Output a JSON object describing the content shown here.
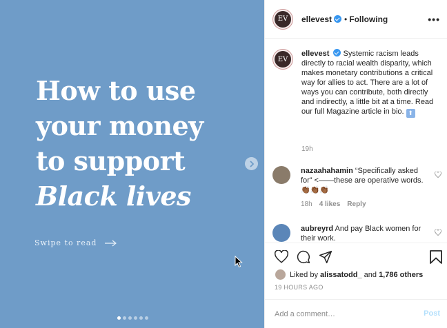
{
  "post_image": {
    "headline_lines": [
      "How to use",
      "your money",
      "to support"
    ],
    "headline_italic": "Black lives",
    "swipe_text": "Swipe to read",
    "icons": {
      "arrow": "arrow-right-icon",
      "next": "chevron-right-icon"
    },
    "carousel": {
      "count": 6,
      "active_index": 0
    },
    "background_color": "#6f9cc8"
  },
  "header": {
    "username": "ellevest",
    "avatar_text": "EV",
    "separator": "•",
    "follow_status": "Following"
  },
  "caption": {
    "username": "ellevest",
    "text": "Systemic racism leads directly to racial wealth disparity, which makes monetary contributions a critical way for allies to act. There are a lot of ways you can contribute, both directly and indirectly, a little bit at a time. Read our full Magazine article in bio.",
    "emoji": "⬆",
    "time": "19h"
  },
  "comments": [
    {
      "username": "nazaahahamin",
      "text": "“Specifically asked for” <——these are operative words.",
      "emoji": "👏🏾👏🏾👏🏾",
      "time": "18h",
      "likes": "4 likes",
      "reply": "Reply"
    },
    {
      "username": "aubreyrd",
      "text": "And pay Black women for their work."
    }
  ],
  "actions": {
    "liked_prefix": "Liked by",
    "liked_user": "alissatodd_",
    "liked_and": "and",
    "liked_others": "1,786 others",
    "time_ago": "19 HOURS AGO"
  },
  "add_comment": {
    "placeholder": "Add a comment…",
    "post_label": "Post"
  },
  "colors": {
    "accent": "#3897f0",
    "post_disabled": "#b2dffc",
    "muted": "#8e8e8e"
  }
}
